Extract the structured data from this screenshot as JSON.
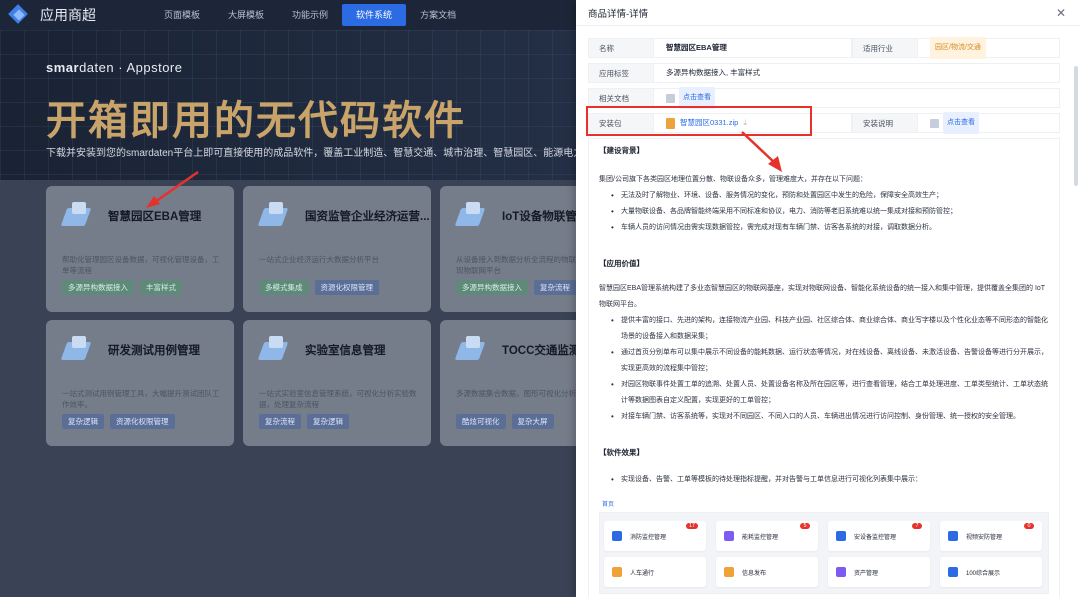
{
  "app": {
    "title": "应用商超"
  },
  "nav": [
    "页面模板",
    "大屏模板",
    "功能示例",
    "软件系统",
    "方案文档"
  ],
  "hero": {
    "brand_bold": "smar",
    "brand_rest": "daten · Appstore",
    "title": "开箱即用的无代码软件",
    "subtitle": "下载并安装到您的smardaten平台上即可直接使用的成品软件，覆盖工业制造、智慧交通、城市治理、智慧园区、能源电力等多类"
  },
  "cards": [
    {
      "title": "智慧园区EBA管理",
      "desc": "帮助化管理园区设备数据，可视化管理设备，工单等流程",
      "tags": [
        {
          "text": "多源异构数据接入",
          "style": "green"
        },
        {
          "text": "丰富样式",
          "style": "green"
        }
      ]
    },
    {
      "title": "国资监管企业经济运营...",
      "desc": "一站式企业经济运行大数据分析平台",
      "tags": [
        {
          "text": "多模式集成",
          "style": "green"
        },
        {
          "text": "资源化权限管理",
          "style": "blue"
        }
      ]
    },
    {
      "title": "IoT设备物联管",
      "desc": "从设备接入到数据分析全流程的物联网管理，实现物联网平台",
      "tags": [
        {
          "text": "多源异构数据接入",
          "style": "green"
        },
        {
          "text": "复杂流程",
          "style": "blue"
        }
      ]
    },
    {
      "title": "研发测试用例管理",
      "desc": "一站式测试用例管理工具，大幅提升测试团队工作效率。",
      "tags": [
        {
          "text": "复杂逻辑",
          "style": "blue"
        },
        {
          "text": "资源化权限管理",
          "style": "blue"
        }
      ]
    },
    {
      "title": "实验室信息管理",
      "desc": "一站式实验室信息管理系统，可视化分析实验数据，处理复杂流程",
      "tags": [
        {
          "text": "复杂流程",
          "style": "blue"
        },
        {
          "text": "复杂逻辑",
          "style": "blue"
        }
      ]
    },
    {
      "title": "TOCC交通监测",
      "desc": "多源数据集合数据，图形可视化分析交通数据",
      "tags": [
        {
          "text": "酷炫可视化",
          "style": "blue"
        },
        {
          "text": "复杂大屏",
          "style": "blue"
        }
      ]
    }
  ],
  "drawer": {
    "title": "商品详情-详情",
    "rows": {
      "name_label": "名称",
      "name_value": "智慧园区EBA管理",
      "industry_label": "适用行业",
      "industry_value": "园区/物流/交通",
      "tags_label": "应用标签",
      "tags_value": "多源异构数据接入, 丰富样式",
      "docs_label": "相关文档",
      "docs_link": "点击查看",
      "package_label": "安装包",
      "package_file": "智慧园区0331.zip",
      "install_label": "安装说明",
      "install_link": "点击查看"
    },
    "content": {
      "s1_title": "【建设背景】",
      "s1_para": "集团/公司旗下各类园区地理位置分散、物联设备众多，管理难度大，并存在以下问题：",
      "s1_bullets": [
        "无法及时了解物业、环境、设备、服务情况的变化，预防和处置园区中发生的危险，保障安全高效生产；",
        "大量物联设备、各品牌智能终端采用不同标准和协议，电力、消防等老旧系统难以统一集成对接和预防管控；",
        "车辆人员的访问情况由需实现数据管控，需完成对现有车辆门禁、访客各系统的对接，调取数据分析。"
      ],
      "s2_title": "【应用价值】",
      "s2_para": "智慧园区EBA管理系统构建了多业态智慧园区的物联网基座，实现对物联网设备、智能化系统设备的统一接入和集中管理，提供覆盖全集团的 IoT物联网平台。",
      "s2_bullets": [
        "提供丰富的接口、先进的架构，连接物流产业园、科技产业园、社区综合体、商业综合体、商业写字楼以及个性化业态等不同形态的智能化场景的设备接入和数据采集；",
        "通过首页分别单布可以集中展示不同设备的能耗数据、运行状态等情况，对在线设备、离线设备、未激活设备、告警设备等进行分开展示，实现更高效的流程集中管控；",
        "对园区物联事件处置工单的追溯、处置人员、处置设备名称及所在园区等，进行查看管理，结合工单处理进度、工单类型统计、工单状态统计等数据图表自定义配置，实现更好的工单管控；",
        "对接车辆门禁、访客系统等，实现对不同园区、不同入口的人员、车辆进出情况进行访问控制、身份管理、统一授权的安全管理。"
      ],
      "s3_title": "【软件效果】",
      "s3_bullets": [
        "实现设备、告警、工单等模板的待处理指标提醒，并对告警与工单信息进行可视化列表集中展示："
      ]
    },
    "preview": {
      "label": "首页",
      "tiles": [
        {
          "label": "消防监控管理",
          "badge": "17",
          "color": "#2b6be4"
        },
        {
          "label": "能耗监控管理",
          "badge": "5",
          "color": "#7c5cf0"
        },
        {
          "label": "安设备监控管理",
          "badge": "7",
          "color": "#2b6be4"
        },
        {
          "label": "视频安防管理",
          "badge": "0",
          "color": "#2b6be4"
        },
        {
          "label": "人车通行",
          "badge": "",
          "color": "#f0a23a"
        },
        {
          "label": "信息发布",
          "badge": "",
          "color": "#f0a23a"
        },
        {
          "label": "资产管理",
          "badge": "",
          "color": "#7c5cf0"
        },
        {
          "label": "100综合展示",
          "badge": "",
          "color": "#2b6be4"
        }
      ]
    }
  }
}
